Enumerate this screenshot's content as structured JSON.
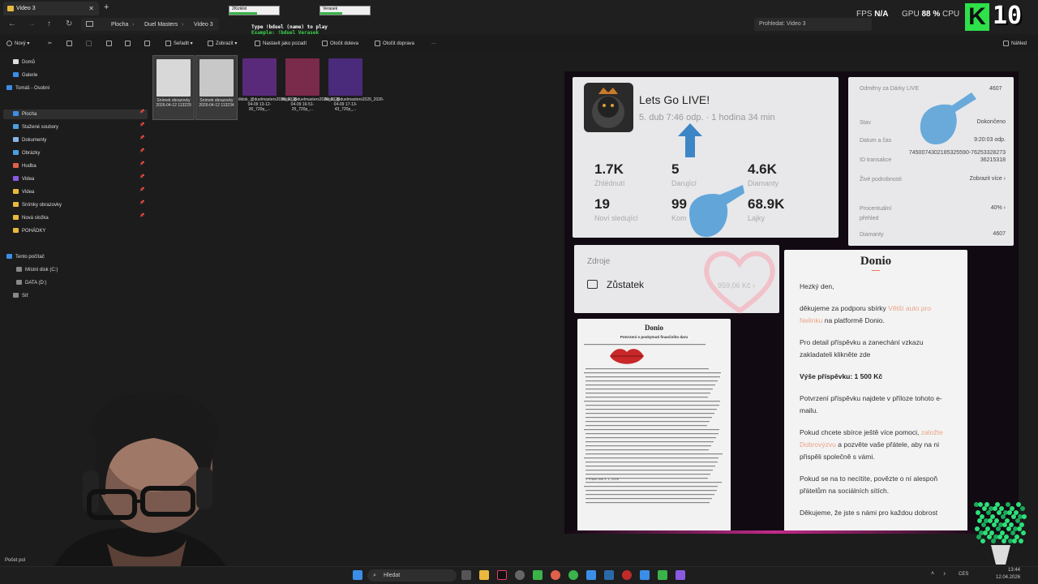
{
  "window": {
    "tab_title": "Video 3",
    "new_tab": "+",
    "close": "✕"
  },
  "overlay": {
    "bar1_label": "2Kizkilol",
    "bar2_label": "Verasek",
    "hint_line1": "Type !bduel (name) to play",
    "hint_line2": "Example: !bduel Verasek",
    "bar1_fill": 0.55,
    "bar2_fill": 0.45
  },
  "breadcrumb": [
    "Plocha",
    "Duel Masters",
    "Video 3"
  ],
  "search": {
    "placeholder": "Prohledat: Video 3"
  },
  "hud": {
    "fps_label": "FPS",
    "fps_value": "N/A",
    "gpu_label": "GPU",
    "gpu_value": "88 %",
    "cpu_label": "CPU",
    "logo_letter": "K",
    "logo_number": "10"
  },
  "toolbar": {
    "new": "Nový",
    "sort": "Seřadit",
    "view": "Zobrazit",
    "set_background": "Nastavit jako pozadí",
    "rotate_left": "Otočit doleva",
    "rotate_right": "Otočit doprava",
    "more": "···",
    "preview": "Náhled"
  },
  "sidebar": {
    "top": [
      {
        "label": "Domů",
        "color": "#ddd"
      },
      {
        "label": "Galerie",
        "color": "#3b8ee8"
      },
      {
        "label": "Tomáš - Osobní",
        "color": "#3b8ee8"
      }
    ],
    "pinned": [
      {
        "label": "Plocha",
        "color": "#3b8ee8"
      },
      {
        "label": "Stažené soubory",
        "color": "#4aa0e0"
      },
      {
        "label": "Dokumenty",
        "color": "#8ab4e8"
      },
      {
        "label": "Obrázky",
        "color": "#4aa0e0"
      },
      {
        "label": "Hudba",
        "color": "#e0604a"
      },
      {
        "label": "Videa",
        "color": "#8a5ae0"
      },
      {
        "label": "Videa",
        "color": "#e8b93c"
      },
      {
        "label": "Snímky obrazovky",
        "color": "#e8b93c"
      },
      {
        "label": "Nová složka",
        "color": "#e8b93c"
      },
      {
        "label": "POHÁDKY",
        "color": "#e8b93c"
      }
    ],
    "this_pc": "Tento počítač",
    "drives": [
      "Místní disk (C:)",
      "DATA (D:)",
      "Síť"
    ]
  },
  "files": [
    {
      "name": "Snímek obrazovky 2026-04-12 113229",
      "kind": "screenshot",
      "color": "#d8d8d8"
    },
    {
      "name": "Snímek obrazovky 2026-04-12 113234",
      "kind": "screenshot",
      "color": "#c8c8c8"
    },
    {
      "name": "tiktok_@duelmasters2026_2026-04-09 13-12-00_720p_...",
      "kind": "video",
      "color": "#5a2a7a"
    },
    {
      "name": "tiktok_@duelmasters2026_2026-04-09 16-51-25_720p_...",
      "kind": "video",
      "color": "#7a2a4a"
    },
    {
      "name": "tiktok_@duelmasters2026_2026-04-09 17-13-43_720p_...",
      "kind": "video",
      "color": "#4a2a7a"
    }
  ],
  "status": {
    "items_count": "Počet pol"
  },
  "live": {
    "title": "Lets Go LIVE!",
    "subtitle": "5. dub 7:46 odp. · 1 hodina 34 min",
    "views": "1.7K",
    "views_label": "Zhlédnutí",
    "donors": "5",
    "donors_label": "Darující",
    "diamonds": "4.6K",
    "diamonds_label": "Diamanty",
    "followers": "19",
    "followers_label": "Noví sledující",
    "comments": "99",
    "comments_label": "Kom",
    "likes": "68.9K",
    "likes_label": "Lajky"
  },
  "reward": {
    "title": "Odměny za Dárky LIVE",
    "title_value": "4607",
    "rows": [
      {
        "label": "Stav",
        "value": "Dokončeno"
      },
      {
        "label": "Datum a čas",
        "value": "9:20:03 odp."
      },
      {
        "label": "ID transakce",
        "value": "7450074302185325590-7625332827336215318"
      },
      {
        "label": "Živé podrobnosti",
        "value": "Zobrazit více ›"
      },
      {
        "label": "Procentuální přehled",
        "value": "40% ›"
      },
      {
        "label": "Diamanty",
        "value": "4607"
      }
    ]
  },
  "source": {
    "label": "Zdroje",
    "balance": "Zůstatek",
    "amount": "959,06 Kč ›"
  },
  "letter": {
    "header": "Donio",
    "doc_title": "Potvrzení o poskytnutí finančního daru",
    "doc_date": "V Praze dne 3. 1. 2026"
  },
  "donio": {
    "title": "Donio",
    "greeting": "Hezký den,",
    "p1a": "děkujeme za podporu sbírky ",
    "p1link": "Větší auto pro Nelinku",
    "p1b": " na platformě Donio.",
    "p2": "Pro detail příspěvku a zanechání vzkazu zakladateli klikněte zde",
    "p3": "Výše příspěvku: 1 500 Kč",
    "p4": "Potvrzení příspěvku najdete v příloze tohoto e-mailu.",
    "p5a": "Pokud chcete sbírce ještě více pomoci, ",
    "p5link": "založte Dobrovýzvu",
    "p5b": " a pozvěte vaše přátele, aby na ni přispěli společně s vámi.",
    "p6": "Pokud se na to necítíte, povězte o ní alespoň přátelům na sociálních sítích.",
    "p7": "Děkujeme, že jste s námi pro každou dobrost"
  },
  "taskbar": {
    "search": "Hledat",
    "lang": "CES",
    "time": "13:44",
    "date": "12.04.2026"
  }
}
